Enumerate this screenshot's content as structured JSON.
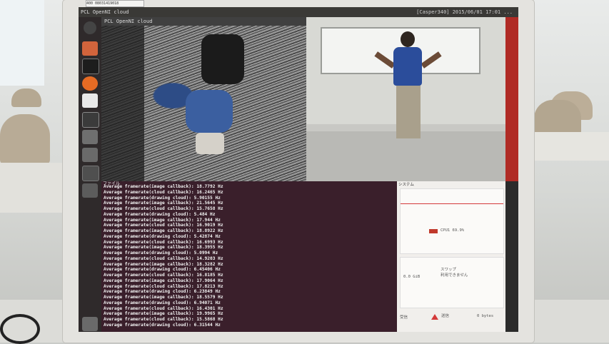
{
  "top_panel": {
    "app_title": "PCL OpenNI cloud",
    "status_text": "[Casper340] 2015/06/01 17:01 ..."
  },
  "sticker": {
    "text": "400 08031419018"
  },
  "pcl_window": {
    "title": "PCL OpenNI cloud"
  },
  "terminal": {
    "header": "ファイル",
    "lines": [
      "Average framerate(image callback): 18.7792 Hz",
      "Average framerate(cloud callback): 16.2465 Hz",
      "Average framerate(drawing cloud): 5.90155 Hz",
      "Average framerate(image callback): 21.5645 Hz",
      "Average framerate(cloud callback): 15.7658 Hz",
      "Average framerate(drawing cloud): 5.484 Hz",
      "Average framerate(image callback): 17.944 Hz",
      "Average framerate(cloud callback): 16.9019 Hz",
      "Average framerate(image callback): 18.8922 Hz",
      "Average framerate(drawing cloud): 5.42874 Hz",
      "Average framerate(cloud callback): 16.6993 Hz",
      "Average framerate(image callback): 18.3955 Hz",
      "Average framerate(drawing cloud): 5.0994 Hz",
      "Average framerate(cloud callback): 14.9203 Hz",
      "Average framerate(image callback): 18.3282 Hz",
      "Average framerate(drawing cloud): 6.45406 Hz",
      "Average framerate(cloud callback): 16.8185 Hz",
      "Average framerate(image callback): 17.9064 Hz",
      "Average framerate(cloud callback): 17.8213 Hz",
      "Average framerate(drawing cloud): 6.23849 Hz",
      "Average framerate(image callback): 18.5579 Hz",
      "Average framerate(drawing cloud): 6.94071 Hz",
      "Average framerate(cloud callback): 16.4301 Hz",
      "Average framerate(image callback): 19.9965 Hz",
      "Average framerate(cloud callback): 15.5868 Hz",
      "Average framerate(drawing cloud): 6.31544 Hz"
    ]
  },
  "system_monitor": {
    "title": "システム",
    "cpu_label": "CPU1 69.9%",
    "swap_label": "スワップ",
    "swap_sub": "利用できません",
    "ok_label": "0.0 GiB",
    "recv_label": "受信",
    "send_label": "送信",
    "rate_label": "0 bytes"
  },
  "colors": {
    "accent_red": "#c0392b",
    "terminal_bg": "#3a1f2b",
    "launcher_bg": "#2f2a2b"
  }
}
